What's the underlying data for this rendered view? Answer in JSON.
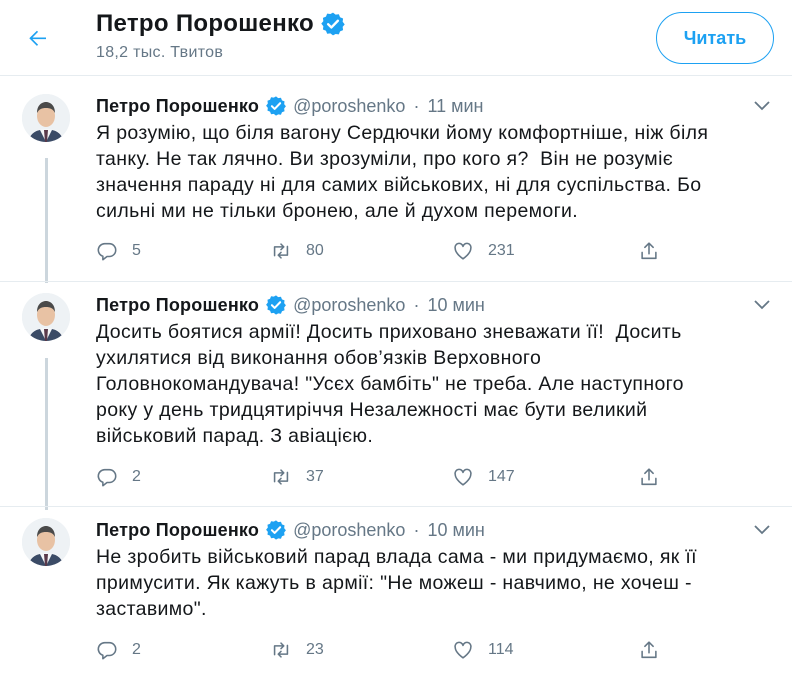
{
  "header": {
    "name": "Петро Порошенко",
    "tweet_count": "18,2 тыс. Твитов",
    "follow_label": "Читать"
  },
  "tweets": [
    {
      "name": "Петро Порошенко",
      "handle": "@poroshenko",
      "dot": "·",
      "time": "11 мин",
      "text": "Я розумію, що біля вагону Сердючки йому комфортніше, ніж біля\nтанку. Не так лячно. Ви зрозуміли, про кого я?  Він не розуміє\nзначення параду ні для самих військових, ні для суспільства. Бо\nсильні ми не тільки бронею, але й духом перемоги.",
      "replies": "5",
      "retweets": "80",
      "likes": "231"
    },
    {
      "name": "Петро Порошенко",
      "handle": "@poroshenko",
      "dot": "·",
      "time": "10 мин",
      "text": "Досить боятися армії! Досить приховано зневажати її!  Досить\nухилятися від виконання обов’язків Верховного\nГоловнокомандувача! \"Усєх бамбіть\" не треба. Але наступного\nроку у день тридцятиріччя Незалежності має бути великий\nвійськовий парад. З авіацією.",
      "replies": "2",
      "retweets": "37",
      "likes": "147"
    },
    {
      "name": "Петро Порошенко",
      "handle": "@poroshenko",
      "dot": "·",
      "time": "10 мин",
      "text": "Не зробить військовий парад влада сама - ми придумаємо, як її\nпримусити. Як кажуть в армії: \"Не можеш - навчимо, не хочеш -\nзаставимо\".",
      "replies": "2",
      "retweets": "23",
      "likes": "114"
    }
  ],
  "icons": {
    "back": "arrow-left-icon",
    "verified": "verified-badge-icon",
    "caret": "chevron-down-icon",
    "reply": "reply-icon",
    "retweet": "retweet-icon",
    "like": "heart-icon",
    "share": "share-icon"
  },
  "colors": {
    "accent": "#1da1f2",
    "secondary_text": "#657786",
    "thread_line": "#ccd6dd",
    "border": "#e6ecf0"
  }
}
